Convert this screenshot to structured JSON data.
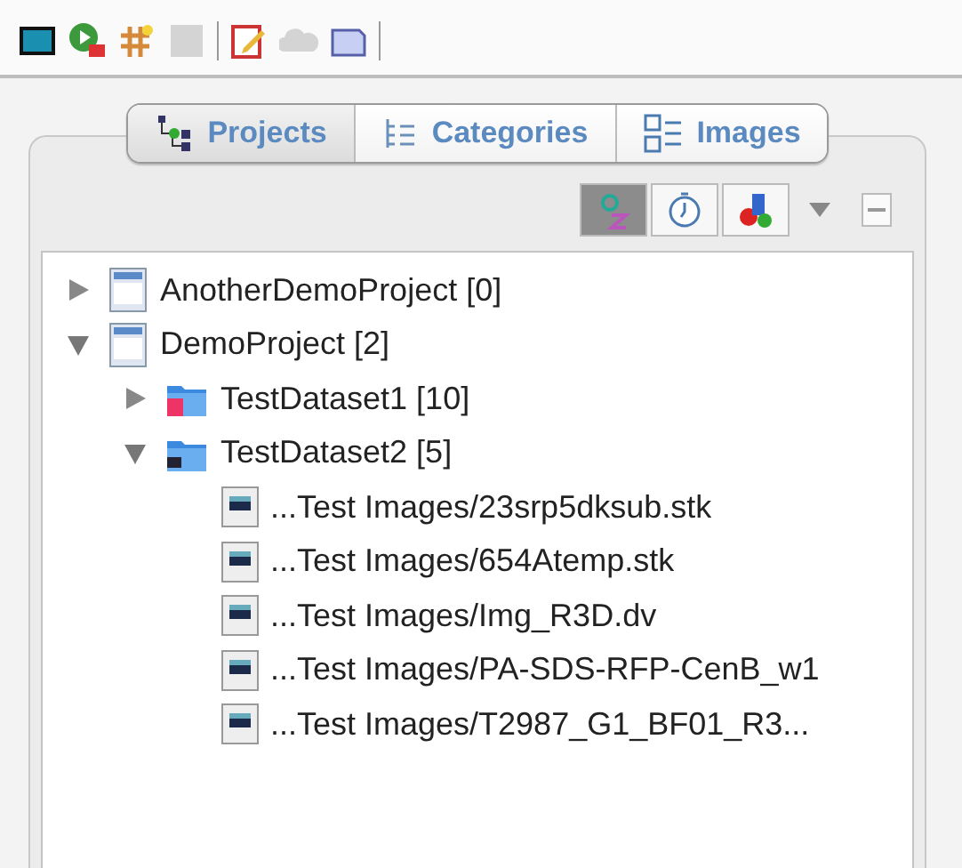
{
  "toolbar": [
    {
      "kind": "monitor",
      "disabled": false
    },
    {
      "kind": "run",
      "disabled": false
    },
    {
      "kind": "grid",
      "disabled": false
    },
    {
      "kind": "square",
      "disabled": true
    },
    {
      "kind": "separator"
    },
    {
      "kind": "edit",
      "disabled": false
    },
    {
      "kind": "cloud",
      "disabled": true
    },
    {
      "kind": "tray",
      "disabled": false
    },
    {
      "kind": "separator"
    }
  ],
  "tabs": [
    {
      "label": "Projects",
      "kind": "projects",
      "selected": true
    },
    {
      "label": "Categories",
      "kind": "categories",
      "selected": false
    },
    {
      "label": "Images",
      "kind": "images",
      "selected": false
    }
  ],
  "sort_buttons": [
    {
      "kind": "alpha",
      "selected": true
    },
    {
      "kind": "time",
      "selected": false
    },
    {
      "kind": "color",
      "selected": false
    },
    {
      "kind": "menu",
      "selected": false
    },
    {
      "kind": "collapse",
      "selected": false
    }
  ],
  "tree": [
    {
      "label": "AnotherDemoProject [0]",
      "kind": "project",
      "expanded": false
    },
    {
      "label": "DemoProject [2]",
      "kind": "project",
      "expanded": true,
      "children": [
        {
          "label": "TestDataset1 [10]",
          "kind": "dataset-tagged",
          "expanded": false
        },
        {
          "label": "TestDataset2 [5]",
          "kind": "dataset",
          "expanded": true,
          "children": [
            {
              "label": "...Test Images/23srp5dksub.stk",
              "kind": "image"
            },
            {
              "label": "...Test Images/654Atemp.stk",
              "kind": "image"
            },
            {
              "label": "...Test Images/Img_R3D.dv",
              "kind": "image"
            },
            {
              "label": "...Test Images/PA-SDS-RFP-CenB_w1",
              "kind": "image"
            },
            {
              "label": "...Test Images/T2987_G1_BF01_R3...",
              "kind": "image"
            }
          ]
        }
      ]
    }
  ]
}
